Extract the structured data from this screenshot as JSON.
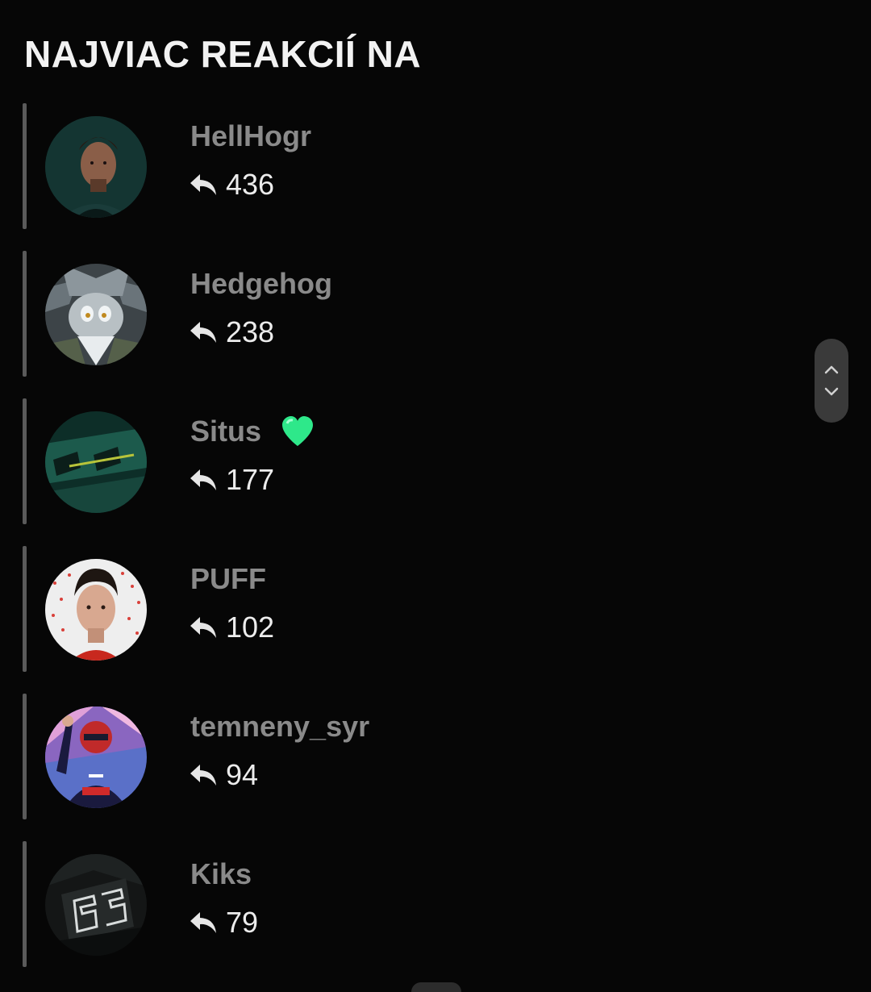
{
  "header": {
    "title": "NAJVIAC REAKCIÍ NA"
  },
  "leaderboard": [
    {
      "username": "HellHogr",
      "reactions": "436",
      "avatar": "portrait-man-dark-green",
      "badge": ""
    },
    {
      "username": "Hedgehog",
      "reactions": "238",
      "avatar": "silver-hedgehog-character",
      "badge": ""
    },
    {
      "username": "Situs",
      "reactions": "177",
      "avatar": "green-racing-car-closeup",
      "badge": "green-heart-icon"
    },
    {
      "username": "PUFF",
      "reactions": "102",
      "avatar": "portrait-man-red-dots",
      "badge": ""
    },
    {
      "username": "temneny_syr",
      "reactions": "94",
      "avatar": "racing-driver-red-bull",
      "badge": ""
    },
    {
      "username": "Kiks",
      "reactions": "79",
      "avatar": "helmet-number-63",
      "badge": ""
    }
  ],
  "icons": {
    "reaction": "reply-arrow-icon",
    "scroll_up": "chevron-up-icon",
    "scroll_down": "chevron-down-icon"
  },
  "colors": {
    "background": "#060606",
    "username": "#8a8a8a",
    "count": "#ececec",
    "bar": "#5a5a5a",
    "heart": "#2ee88a"
  }
}
